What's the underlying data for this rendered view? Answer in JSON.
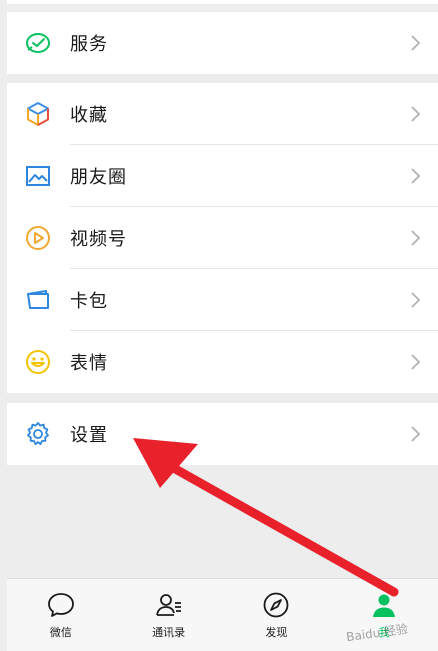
{
  "menu": {
    "group1": [
      {
        "label": "服务",
        "icon": "service-wallet-icon"
      }
    ],
    "group2": [
      {
        "label": "收藏",
        "icon": "favorites-cube-icon"
      },
      {
        "label": "朋友圈",
        "icon": "moments-image-icon"
      },
      {
        "label": "视频号",
        "icon": "channels-play-icon"
      },
      {
        "label": "卡包",
        "icon": "card-wallet-icon"
      },
      {
        "label": "表情",
        "icon": "sticker-smile-icon"
      }
    ],
    "group3": [
      {
        "label": "设置",
        "icon": "settings-gear-icon"
      }
    ]
  },
  "tabbar": {
    "tabs": [
      {
        "label": "微信",
        "icon": "chat-bubble-icon"
      },
      {
        "label": "通讯录",
        "icon": "contacts-icon"
      },
      {
        "label": "发现",
        "icon": "discover-compass-icon"
      },
      {
        "label": "我",
        "icon": "me-person-icon",
        "active": true
      }
    ]
  },
  "colors": {
    "accent": "#07c160",
    "annotation_arrow": "#e8212b"
  }
}
